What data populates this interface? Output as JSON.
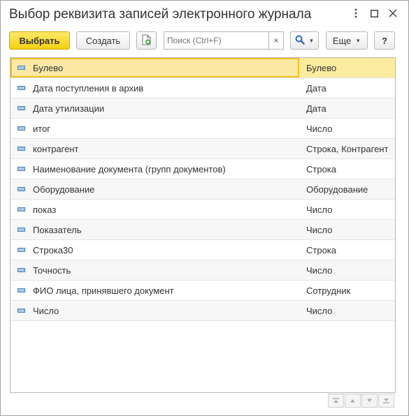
{
  "window": {
    "title": "Выбор реквизита записей электронного журнала"
  },
  "toolbar": {
    "select_label": "Выбрать",
    "create_label": "Создать",
    "search_placeholder": "Поиск (Ctrl+F)",
    "search_value": "",
    "clear_label": "×",
    "more_label": "Еще",
    "help_label": "?"
  },
  "rows": [
    {
      "name": "Булево",
      "type": "Булево"
    },
    {
      "name": "Дата поступления в архив",
      "type": "Дата"
    },
    {
      "name": "Дата утилизации",
      "type": "Дата"
    },
    {
      "name": "итог",
      "type": "Число"
    },
    {
      "name": "контрагент",
      "type": "Строка, Контрагент"
    },
    {
      "name": "Наименование документа (групп документов)",
      "type": "Строка"
    },
    {
      "name": "Оборудование",
      "type": "Оборудование"
    },
    {
      "name": "показ",
      "type": "Число"
    },
    {
      "name": "Показатель",
      "type": "Число"
    },
    {
      "name": "Строка30",
      "type": "Строка"
    },
    {
      "name": "Точность",
      "type": "Число"
    },
    {
      "name": "ФИО лица, принявшего документ",
      "type": "Сотрудник"
    },
    {
      "name": "Число",
      "type": "Число"
    }
  ],
  "selected_row": 0
}
